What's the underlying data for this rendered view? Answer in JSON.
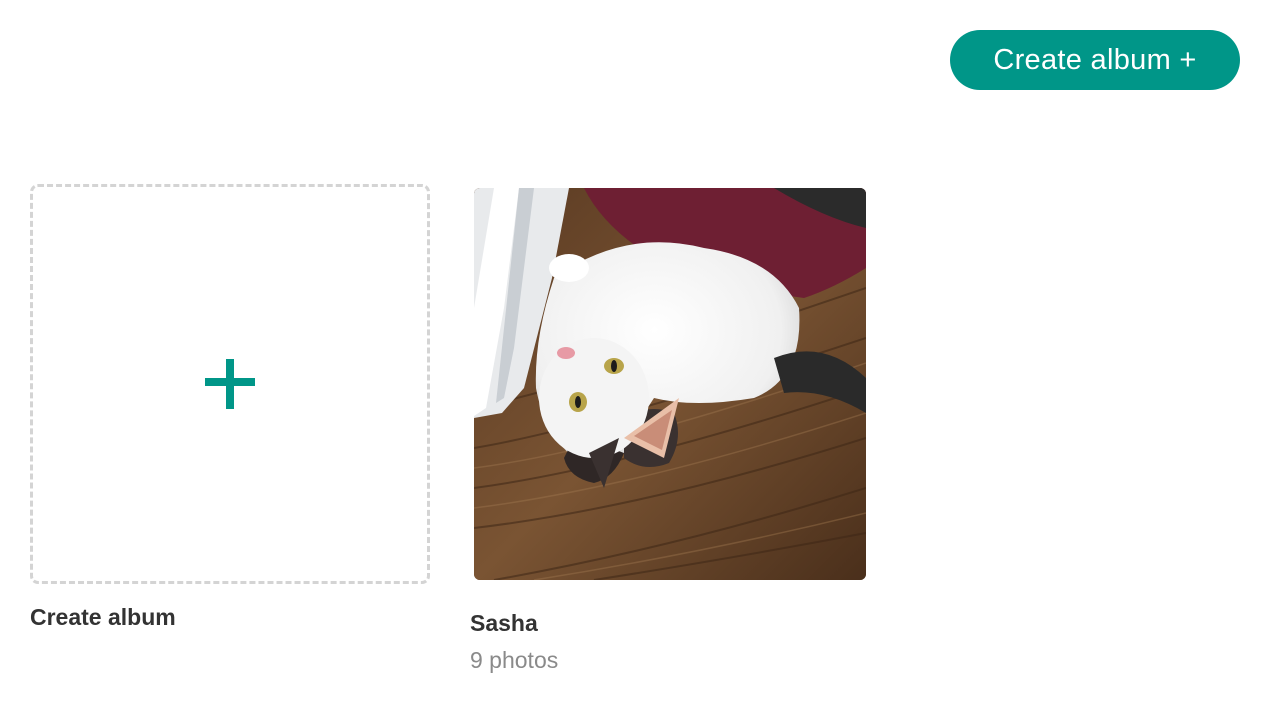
{
  "header": {
    "create_button_label": "Create album +"
  },
  "new_album_tile": {
    "icon": "plus-icon",
    "label": "Create album"
  },
  "albums": [
    {
      "title": "Sasha",
      "count_label": "9 photos",
      "cover": "cat-photo"
    }
  ],
  "colors": {
    "accent": "#009688",
    "tile_border": "#d4d4d4",
    "title_text": "#333333",
    "muted_text": "#8a8a8a"
  }
}
